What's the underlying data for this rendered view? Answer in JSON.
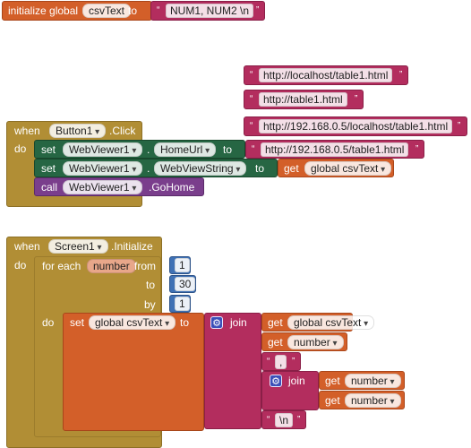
{
  "global_decl": {
    "keyword": "initialize global",
    "var_name": "csvText",
    "to_label": "to",
    "value": "NUM1, NUM2 \\n"
  },
  "floating_strings": [
    "http://localhost/table1.html",
    "http://table1.html",
    "http://192.168.0.5/localhost/table1.html"
  ],
  "button_event": {
    "when_label": "when",
    "component": "Button1",
    "event": ".Click",
    "do_label": "do",
    "set1": {
      "set_label": "set",
      "component": "WebViewer1",
      "property": "HomeUrl",
      "to_label": "to",
      "value": "http://192.168.0.5/table1.html"
    },
    "set2": {
      "set_label": "set",
      "component": "WebViewer1",
      "property": "WebViewString",
      "to_label": "to",
      "get_label": "get",
      "get_var": "global csvText"
    },
    "call": {
      "call_label": "call",
      "component": "WebViewer1",
      "method": ".GoHome"
    }
  },
  "screen_event": {
    "when_label": "when",
    "component": "Screen1",
    "event": ".Initialize",
    "do_label": "do",
    "loop": {
      "for_each_label": "for each",
      "var": "number",
      "from_label": "from",
      "from_value": "1",
      "to_label": "to",
      "to_value": "30",
      "by_label": "by",
      "by_value": "1",
      "do_label": "do"
    },
    "set": {
      "set_label": "set",
      "var": "global csvText",
      "to_label": "to"
    },
    "join": {
      "label": "join",
      "gear_icon": "gear-icon",
      "item1": {
        "get_label": "get",
        "var": "global csvText"
      },
      "item2": {
        "get_label": "get",
        "var": "number"
      },
      "item3": ",",
      "inner_join": {
        "label": "join",
        "gear_icon": "gear-icon",
        "item1": {
          "get_label": "get",
          "var": "number"
        },
        "item2": {
          "get_label": "get",
          "var": "number"
        }
      },
      "item5": "\\n"
    }
  },
  "colors": {
    "variables": "#d35f29",
    "text": "#b32d5e",
    "control": "#b18e35",
    "component_set": "#266643",
    "component_call": "#7a3e8c",
    "math": "#3f71b5"
  }
}
